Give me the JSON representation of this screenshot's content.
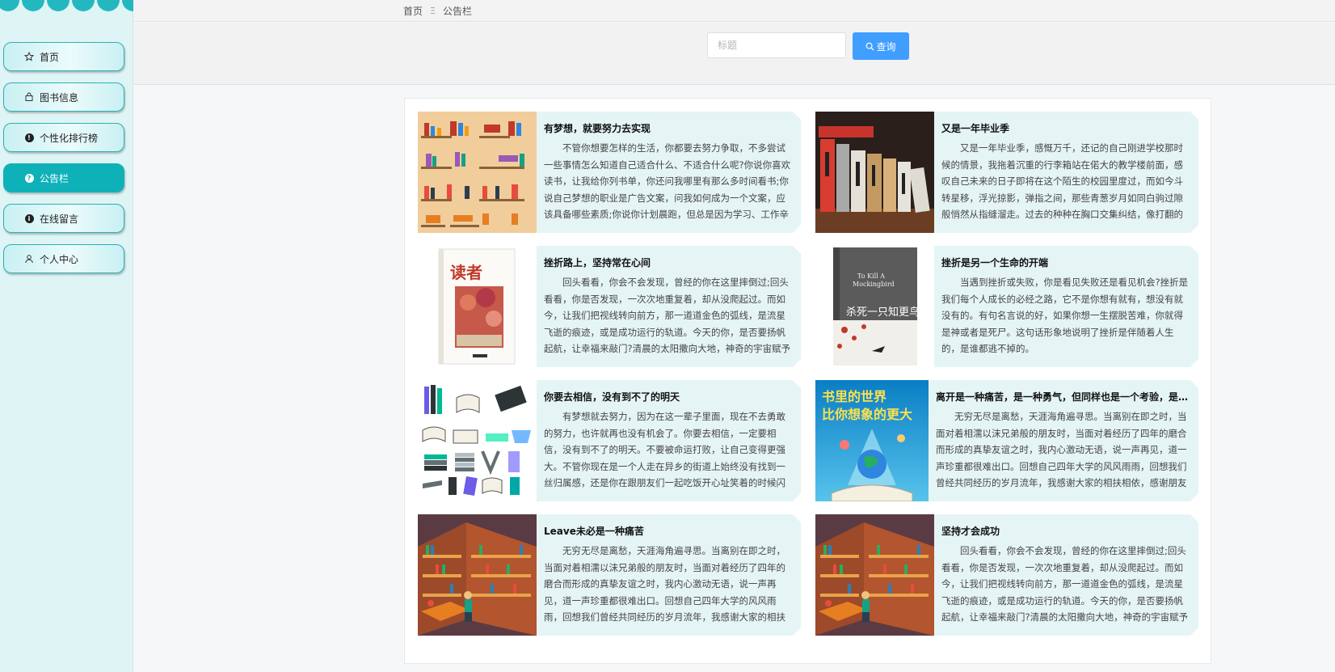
{
  "sidebar": {
    "items": [
      {
        "label": "首页",
        "icon": "star-icon",
        "active": false
      },
      {
        "label": "图书信息",
        "icon": "bag-icon",
        "active": false
      },
      {
        "label": "个性化排行榜",
        "icon": "info-icon",
        "active": false
      },
      {
        "label": "公告栏",
        "icon": "question-icon",
        "active": true
      },
      {
        "label": "在线留言",
        "icon": "info-icon",
        "active": false
      },
      {
        "label": "个人中心",
        "icon": "user-icon",
        "active": false
      }
    ]
  },
  "breadcrumb": {
    "home": "首页",
    "separator": "Ξ",
    "current": "公告栏"
  },
  "search": {
    "placeholder": "标题",
    "value": "",
    "button_label": "查询"
  },
  "colors": {
    "accent": "#0fb1b9",
    "primary_button": "#409eff",
    "card_bg": "#e5f5f5"
  },
  "cards": [
    {
      "title": "有梦想，就要努力去实现",
      "image": "book-shelves-illustration",
      "body": "不管你想要怎样的生活，你都要去努力争取，不多尝试一些事情怎么知道自己适合什么、不适合什么呢?你说你喜欢读书，让我给你列书单，你还问我哪里有那么多时间看书;你说自己梦想的职业是广告文案，问我如何成为一个文案，应该具备哪些素质;你说你计划晨跑，但总是因为学习、工作辛苦"
    },
    {
      "title": "又是一年毕业季",
      "image": "stacked-books-photo",
      "body": "又是一年毕业季，感慨万千，还记的自己刚进学校那时候的情景，我拖着沉重的行李箱站在偌大的教学楼前面，感叹自己未来的日子即将在这个陌生的校园里度过，而如今斗转星移，浮光掠影，弹指之间，那些青葱岁月如同白驹过隙般悄然从指缝溜走。过去的种种在胸口交集纠结，像打翻的"
    },
    {
      "title": "挫折路上，坚持常在心间",
      "image": "duzhe-magazine-cover",
      "body": "回头看看，你会不会发现，曾经的你在这里摔倒过;回头看看，你是否发现，一次次地重复着，却从没爬起过。而如今，让我们把视线转向前方，那一道道金色的弧线，是流星飞逝的痕迹，或是成功运行的轨道。今天的你，是否要扬帆起航，让幸福来敲门?清晨的太阳撒向大地，神奇的宇宙赋予"
    },
    {
      "title": "挫折是另一个生命的开端",
      "image": "to-kill-a-mockingbird-cover",
      "body": "当遇到挫折或失败，你是看见失败还是看见机会?挫折是我们每个人成长的必经之路，它不是你想有就有，想没有就没有的。有句名言说的好，如果你想一生摆脱苦难，你就得是神或者是死尸。这句话形象地说明了挫折是伴随着人生的，是谁都逃不掉的。"
    },
    {
      "title": "你要去相信，没有到不了的明天",
      "image": "book-icons-grid",
      "body": "有梦想就去努力，因为在这一辈子里面，现在不去勇敢的努力，也许就再也没有机会了。你要去相信，一定要相信，没有到不了的明天。不要被命运打败，让自己变得更强大。不管你现在是一个人走在异乡的街道上始终没有找到一丝归属感，还是你在跟朋友们一起吃饭开心址笑着的时候闪"
    },
    {
      "title": "离开是一种痛苦，是一种勇气，但同样也是一个考验，是一个...",
      "image": "book-world-poster",
      "body": "无穷无尽是离愁，天涯海角遍寻思。当离别在即之时，当面对着相濡以沫兄弟般的朋友时，当面对着经历了四年的磨合而形成的真挚友谊之时，我内心激动无语，说一声再见，道一声珍重都很难出口。回想自己四年大学的风风雨雨，回想我们曾经共同经历的岁月流年，我感谢大家的相扶相依，感谢朋友"
    },
    {
      "title": "Leave未必是一种痛苦",
      "image": "library-isometric-illustration",
      "body": "无穷无尽是离愁，天涯海角遍寻思。当离别在即之时，当面对着相濡以沫兄弟般的朋友时，当面对着经历了四年的磨合而形成的真挚友谊之时，我内心激动无语，说一声再见，道一声珍重都很难出口。回想自己四年大学的风风雨雨，回想我们曾经共同经历的岁月流年，我感谢大家的相扶"
    },
    {
      "title": "坚持才会成功",
      "image": "library-isometric-illustration",
      "body": "回头看看，你会不会发现，曾经的你在这里摔倒过;回头看看，你是否发现，一次次地重复着，却从没爬起过。而如今，让我们把视线转向前方，那一道道金色的弧线，是流星飞逝的痕迹，或是成功运行的轨道。今天的你，是否要扬帆起航，让幸福来敲门?清晨的太阳撒向大地，神奇的宇宙赋予"
    }
  ]
}
